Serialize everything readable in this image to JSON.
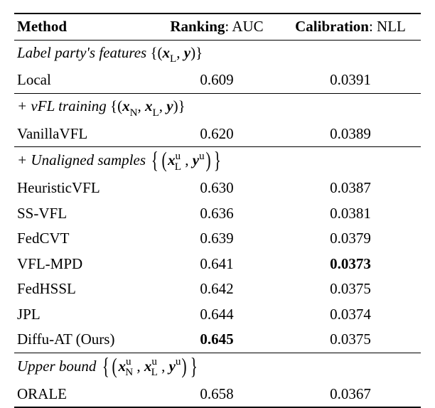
{
  "chart_data": {
    "type": "table",
    "columns": [
      "Method",
      "Ranking: AUC",
      "Calibration: NLL"
    ],
    "sections": [
      {
        "title": "Label party's features {(x_L, y)}",
        "rows": [
          {
            "method": "Local",
            "auc": 0.609,
            "nll": 0.0391
          }
        ]
      },
      {
        "title": "+ vFL training {(x_N, x_L, y)}",
        "rows": [
          {
            "method": "VanillaVFL",
            "auc": 0.62,
            "nll": 0.0389
          }
        ]
      },
      {
        "title": "+ Unaligned samples {(x_L^u, y^u)}",
        "rows": [
          {
            "method": "HeuristicVFL",
            "auc": 0.63,
            "nll": 0.0387
          },
          {
            "method": "SS-VFL",
            "auc": 0.636,
            "nll": 0.0381
          },
          {
            "method": "FedCVT",
            "auc": 0.639,
            "nll": 0.0379
          },
          {
            "method": "VFL-MPD",
            "auc": 0.641,
            "nll": 0.0373,
            "nll_bold": true
          },
          {
            "method": "FedHSSL",
            "auc": 0.642,
            "nll": 0.0375
          },
          {
            "method": "JPL",
            "auc": 0.644,
            "nll": 0.0374
          },
          {
            "method": "Diffu-AT (Ours)",
            "auc": 0.645,
            "nll": 0.0375,
            "auc_bold": true
          }
        ]
      },
      {
        "title": "Upper bound {(x_N^u, x_L^u, y^u)}",
        "rows": [
          {
            "method": "ORALE",
            "auc": 0.658,
            "nll": 0.0367
          }
        ]
      }
    ]
  },
  "headers": {
    "method": "Method",
    "rank_label": "Ranking",
    "rank_metric": ": AUC",
    "cal_label": "Calibration",
    "cal_metric": ": NLL"
  },
  "sections": {
    "s1_prefix": "Label party's features ",
    "s2_prefix": "+ vFL training ",
    "s3_prefix": "+ Unaligned samples ",
    "s4_prefix": "Upper bound "
  },
  "rows": {
    "local": {
      "m": "Local",
      "auc": "0.609",
      "nll": "0.0391"
    },
    "vanilla": {
      "m": "VanillaVFL",
      "auc": "0.620",
      "nll": "0.0389"
    },
    "heuristic": {
      "m": "HeuristicVFL",
      "auc": "0.630",
      "nll": "0.0387"
    },
    "ssvfl": {
      "m": "SS-VFL",
      "auc": "0.636",
      "nll": "0.0381"
    },
    "fedcvt": {
      "m": "FedCVT",
      "auc": "0.639",
      "nll": "0.0379"
    },
    "vflmpd": {
      "m": "VFL-MPD",
      "auc": "0.641",
      "nll": "0.0373"
    },
    "fedhssl": {
      "m": "FedHSSL",
      "auc": "0.642",
      "nll": "0.0375"
    },
    "jpl": {
      "m": "JPL",
      "auc": "0.644",
      "nll": "0.0374"
    },
    "diffuat": {
      "m": "Diffu-AT (Ours)",
      "auc": "0.645",
      "nll": "0.0375"
    },
    "orale": {
      "m": "ORALE",
      "auc": "0.658",
      "nll": "0.0367"
    }
  }
}
